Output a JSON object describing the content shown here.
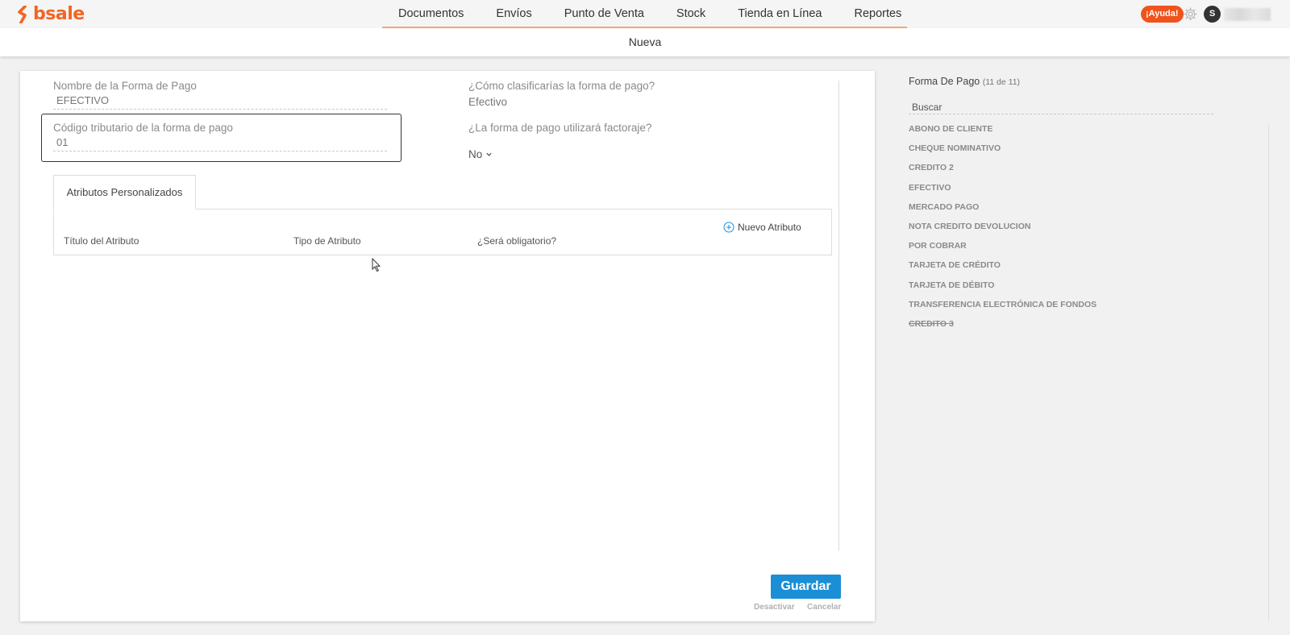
{
  "brand": {
    "name": "bsale",
    "color": "#f26522",
    "logo_icon": "bsale-logo-icon"
  },
  "nav": {
    "items": [
      {
        "label": "Documentos"
      },
      {
        "label": "Envíos"
      },
      {
        "label": "Punto de Venta"
      },
      {
        "label": "Stock"
      },
      {
        "label": "Tienda en Línea"
      },
      {
        "label": "Reportes"
      }
    ],
    "accent": "#f5a77c"
  },
  "header_right": {
    "help_label": "¡Ayuda!",
    "settings_icon": "gear-icon",
    "avatar_initial": "S"
  },
  "subnav": {
    "current": "Nueva"
  },
  "form": {
    "name_label": "Nombre de la Forma de Pago",
    "name_value": "EFECTIVO",
    "tax_code_label": "Código tributario de la forma de pago",
    "tax_code_value": "01",
    "classify_label": "¿Cómo clasificarías la forma de pago?",
    "classify_value": "Efectivo",
    "factoring_label": "¿La forma de pago utilizará factoraje?",
    "factoring_value": "No"
  },
  "attributes": {
    "tab_label": "Atributos Personalizados",
    "columns": [
      "Título del Atributo",
      "Tipo de Atributo",
      "¿Será obligatorio?"
    ],
    "new_label": "Nuevo Atributo"
  },
  "actions": {
    "save_label": "Guardar",
    "deactivate_label": "Desactivar",
    "cancel_label": "Cancelar",
    "primary_color": "#1a8fd6"
  },
  "sidebar": {
    "title": "Forma De Pago",
    "count": "(11 de 11)",
    "search_placeholder": "Buscar",
    "items": [
      {
        "label": "ABONO DE CLIENTE",
        "inactive": false
      },
      {
        "label": "CHEQUE NOMINATIVO",
        "inactive": false
      },
      {
        "label": "CREDITO 2",
        "inactive": false
      },
      {
        "label": "EFECTIVO",
        "inactive": false
      },
      {
        "label": "MERCADO PAGO",
        "inactive": false
      },
      {
        "label": "NOTA CREDITO DEVOLUCION",
        "inactive": false
      },
      {
        "label": "POR COBRAR",
        "inactive": false
      },
      {
        "label": "TARJETA DE CRÉDITO",
        "inactive": false
      },
      {
        "label": "TARJETA DE DÉBITO",
        "inactive": false
      },
      {
        "label": "TRANSFERENCIA ELECTRÓNICA DE FONDOS",
        "inactive": false
      },
      {
        "label": "CREDITO 3",
        "inactive": true
      }
    ]
  }
}
